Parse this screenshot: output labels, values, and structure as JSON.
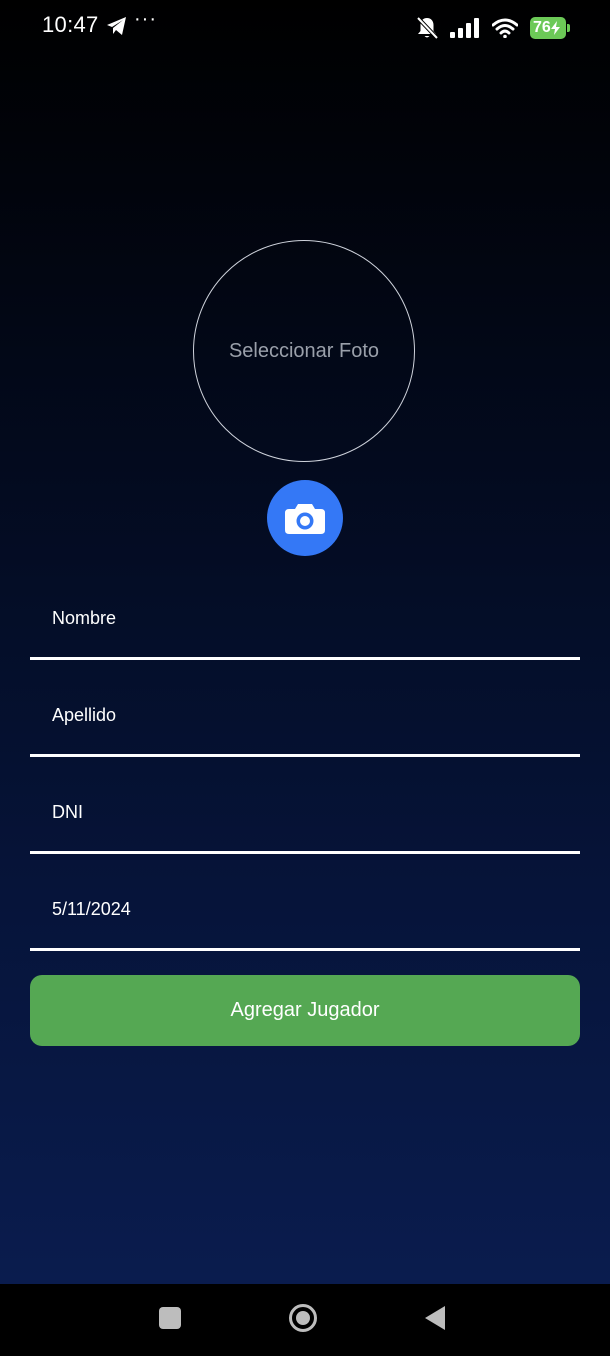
{
  "status_bar": {
    "time": "10:47",
    "more": "···",
    "battery_level": "76",
    "icons": [
      "telegram-icon",
      "bell-off-icon",
      "signal-icon",
      "wifi-icon",
      "battery-charging-icon"
    ]
  },
  "photo": {
    "label": "Seleccionar Foto",
    "camera_icon": "camera-icon"
  },
  "form": {
    "nombre": "Nombre",
    "apellido": "Apellido",
    "dni": "DNI",
    "fecha": "5/11/2024"
  },
  "submit": {
    "label": "Agregar Jugador"
  },
  "colors": {
    "accent": "#3478f6",
    "submit": "#55a853",
    "battery": "#6cc957",
    "background_top": "#000000",
    "background_bottom": "#0a1c4e"
  },
  "nav_bar": {
    "icons": [
      "recents-icon",
      "home-icon",
      "back-icon"
    ]
  }
}
